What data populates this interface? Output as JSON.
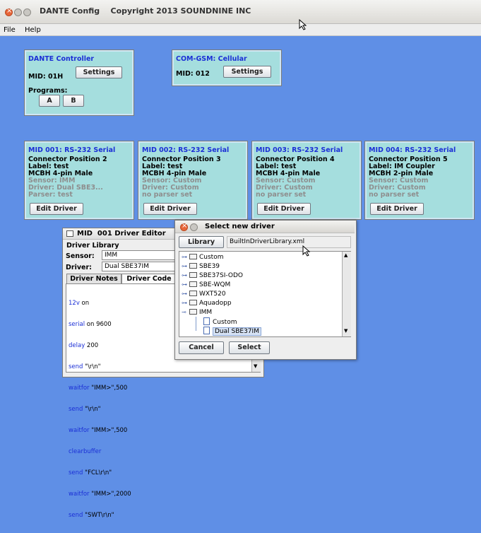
{
  "window": {
    "title": "DANTE Config    Copyright 2013 SOUNDNINE INC"
  },
  "menu": [
    "File",
    "Help"
  ],
  "controller": {
    "title": "DANTE Controller",
    "mid": "MID: 01H",
    "settings": "Settings",
    "programs": "Programs:",
    "prog_a": "A",
    "prog_b": "B"
  },
  "comgsm": {
    "title": "COM-GSM: Cellular",
    "mid": "MID: 012",
    "settings": "Settings"
  },
  "slots": [
    {
      "title": "MID 001: RS-232 Serial",
      "pos": "Connector Position 2",
      "label": "Label: test",
      "cable": "MCBH 4-pin Male",
      "sensor": "Sensor: IMM",
      "driver": "Driver: Dual SBE3...",
      "parser": "Parser: test",
      "edit": "Edit Driver"
    },
    {
      "title": "MID 002: RS-232 Serial",
      "pos": "Connector Position 3",
      "label": "Label: test",
      "cable": "MCBH 4-pin Male",
      "sensor": "Sensor: Custom",
      "driver": "Driver: Custom",
      "parser": "no parser set",
      "edit": "Edit Driver"
    },
    {
      "title": "MID 003: RS-232 Serial",
      "pos": "Connector Position 4",
      "label": "Label: test",
      "cable": "MCBH 4-pin Male",
      "sensor": "Sensor: Custom",
      "driver": "Driver: Custom",
      "parser": "no parser set",
      "edit": "Edit Driver"
    },
    {
      "title": "MID 004: RS-232 Serial",
      "pos": "Connector Position 5",
      "label": "Label: IM Coupler",
      "cable": "MCBH 2-pin Male",
      "sensor": "Sensor: Custom",
      "driver": "Driver: Custom",
      "parser": "no parser set",
      "edit": "Edit Driver"
    }
  ],
  "editor": {
    "title": "MID  001 Driver Editor",
    "library": "Driver Library",
    "sensor_label": "Sensor:",
    "sensor_value": "IMM",
    "driver_label": "Driver:",
    "driver_value": "Dual SBE37IM",
    "tab_notes": "Driver Notes",
    "tab_code": "Driver Code",
    "code": [
      [
        "12v",
        " on"
      ],
      [
        "serial",
        " on 9600"
      ],
      [
        "delay",
        " 200"
      ],
      [
        "send",
        " \"\\r\\n\""
      ],
      [
        "waitfor",
        " \"IMM>\",500"
      ],
      [
        "send",
        " \"\\r\\n\""
      ],
      [
        "waitfor",
        " \"IMM>\",500"
      ],
      [
        "clearbuffer",
        ""
      ],
      [
        "send",
        " \"FCL\\r\\n\""
      ],
      [
        "waitfor",
        " \"IMM>\",2000"
      ],
      [
        "send",
        " \"SWT\\r\\n\""
      ]
    ]
  },
  "selector": {
    "title": "Select new driver",
    "library_btn": "Library",
    "library_file": "BuiltInDriverLibrary.xml",
    "tree": [
      "Custom",
      "SBE39",
      "SBE37SI-ODO",
      "SBE-WQM",
      "WXT520",
      "Aquadopp",
      "IMM"
    ],
    "children": [
      "Custom",
      "Dual SBE37IM"
    ],
    "cancel": "Cancel",
    "select": "Select"
  }
}
